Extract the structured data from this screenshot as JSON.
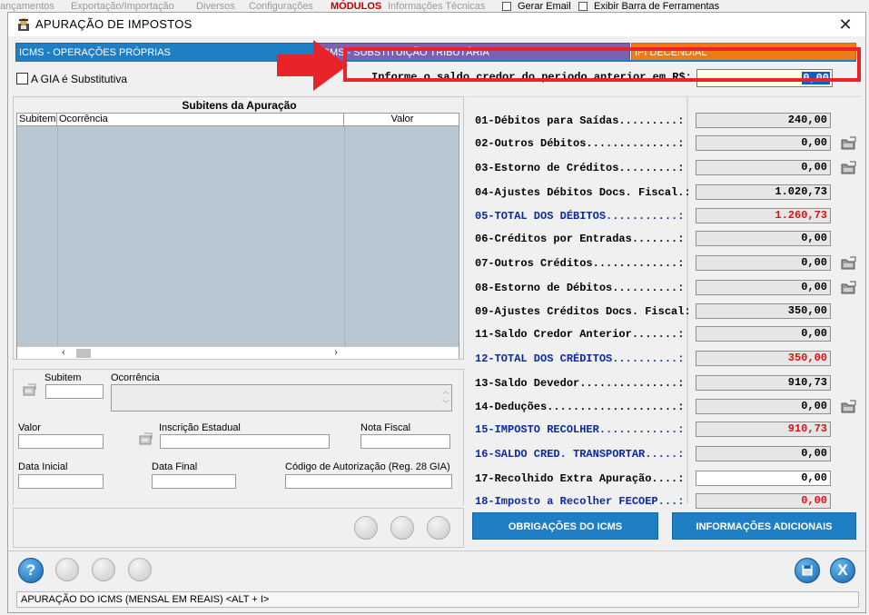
{
  "background_menu": {
    "items": [
      "ançamentos",
      "Exportação/Importação",
      "Diversos",
      "Configurações",
      "MÓDULOS",
      "Informações Técnicas"
    ],
    "gerar_email": "Gerar Email",
    "exibir_barra": "Exibir Barra de Ferramentas"
  },
  "window": {
    "title": "APURAÇÃO  DE  IMPOSTOS",
    "close": "✕"
  },
  "tabs": [
    {
      "label": "ICMS - OPERAÇÕES PRÓPRIAS",
      "color": "#1f7fc6",
      "active": true
    },
    {
      "label": "ICMS - SUBSTITUIÇÃO TRIBUTÁRIA",
      "color": "#7a62b3"
    },
    {
      "label": "IPI DECENDIAL",
      "color": "#f07b12"
    }
  ],
  "gia_label": "A GIA é Substitutiva",
  "saldo": {
    "label": "Informe o saldo credor do periodo anterior em R$:",
    "value": "0,00"
  },
  "subitens": {
    "title": "Subitens da Apuração",
    "columns": [
      "Subitem",
      "Ocorrência",
      "Valor"
    ]
  },
  "form": {
    "subitem": "Subitem",
    "ocorrencia": "Ocorrência",
    "valor": "Valor",
    "inscricao": "Inscrição Estadual",
    "nota_fiscal": "Nota Fiscal",
    "data_inicial": "Data Inicial",
    "data_final": "Data Final",
    "codigo_aut": "Código de Autorização (Reg. 28 GIA)"
  },
  "apuracao": [
    {
      "label": "01-Débitos para Saídas.........:",
      "value": "240,00",
      "blue": false,
      "red": false
    },
    {
      "label": "02-Outros Débitos..............:",
      "value": "0,00",
      "icon": "folder-icon"
    },
    {
      "label": "03-Estorno de Créditos.........:",
      "value": "0,00",
      "icon": "folder-icon"
    },
    {
      "label": "04-Ajustes Débitos Docs. Fiscal.:",
      "value": "1.020,73"
    },
    {
      "label": "05-TOTAL DOS DÉBITOS...........:",
      "value": "1.260,73",
      "blue": true,
      "red": true
    },
    {
      "label": "06-Créditos por Entradas.......:",
      "value": "0,00"
    },
    {
      "label": "07-Outros Créditos.............:",
      "value": "0,00",
      "icon": "folder-icon"
    },
    {
      "label": "08-Estorno de Débitos..........:",
      "value": "0,00",
      "icon": "folder-icon"
    },
    {
      "label": "09-Ajustes Créditos Docs. Fiscal:",
      "value": "350,00"
    },
    {
      "label": "11-Saldo Credor Anterior.......:",
      "value": "0,00"
    },
    {
      "label": "12-TOTAL DOS CRÉDITOS..........:",
      "value": "350,00",
      "blue": true,
      "red": true
    },
    {
      "label": "13-Saldo Devedor...............:",
      "value": "910,73"
    },
    {
      "label": "14-Deduções....................:",
      "value": "0,00",
      "icon": "folder-icon"
    },
    {
      "label": "15-IMPOSTO RECOLHER............:",
      "value": "910,73",
      "blue": true,
      "red": true
    },
    {
      "label": "16-SALDO CRED. TRANSPORTAR.....:",
      "value": "0,00",
      "blue": true
    },
    {
      "label": "17-Recolhido Extra Apuração....:",
      "value": "0,00",
      "white": true
    },
    {
      "label": "18-Imposto a Recolher FECOEP...:",
      "value": "0,00",
      "blue": true,
      "red": true
    }
  ],
  "buttons": {
    "obrigacoes": "OBRIGAÇÕES DO ICMS",
    "informacoes": "INFORMAÇÕES ADICIONAIS",
    "help": "?",
    "close_x": "X"
  },
  "status": "APURAÇÃO  DO  ICMS   (MENSAL EM REAIS)  <ALT + I>"
}
